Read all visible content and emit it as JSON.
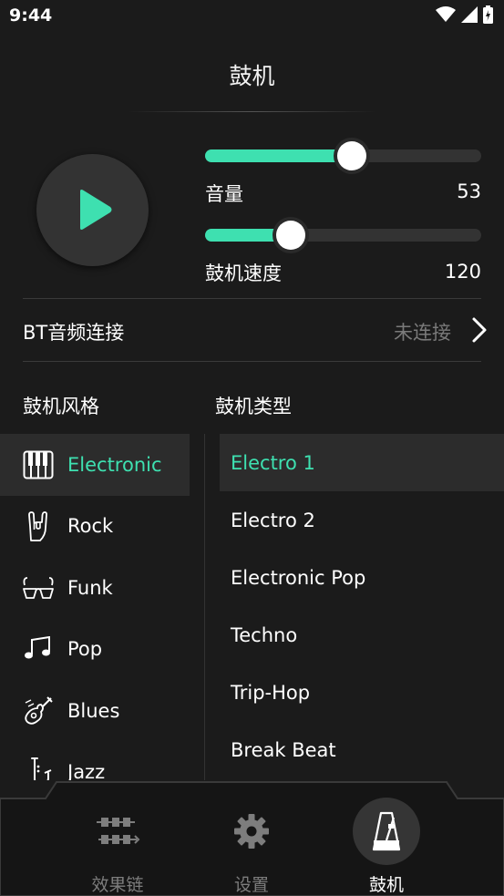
{
  "status_bar": {
    "time": "9:44"
  },
  "header": {
    "title": "鼓机"
  },
  "controls": {
    "volume": {
      "label": "音量",
      "value": "53",
      "level_percent": 53
    },
    "tempo": {
      "label": "鼓机速度",
      "value": "120",
      "level_percent": 31
    }
  },
  "bt": {
    "label": "BT音频连接",
    "status": "未连接"
  },
  "sections": {
    "styles_heading": "鼓机风格",
    "types_heading": "鼓机类型"
  },
  "styles": [
    {
      "label": "Electronic",
      "icon": "piano-keys-icon",
      "active": true
    },
    {
      "label": "Rock",
      "icon": "rock-hand-icon",
      "active": false
    },
    {
      "label": "Funk",
      "icon": "funk-glasses-icon",
      "active": false
    },
    {
      "label": "Pop",
      "icon": "music-notes-icon",
      "active": false
    },
    {
      "label": "Blues",
      "icon": "guitar-icon",
      "active": false
    },
    {
      "label": "Jazz",
      "icon": "saxophone-icon",
      "active": false
    }
  ],
  "types": [
    {
      "label": "Electro 1",
      "active": true
    },
    {
      "label": "Electro 2",
      "active": false
    },
    {
      "label": "Electronic Pop",
      "active": false
    },
    {
      "label": "Techno",
      "active": false
    },
    {
      "label": "Trip-Hop",
      "active": false
    },
    {
      "label": "Break Beat",
      "active": false
    }
  ],
  "nav": [
    {
      "label": "效果链",
      "icon": "effects-chain-icon",
      "active": false
    },
    {
      "label": "设置",
      "icon": "gear-icon",
      "active": false
    },
    {
      "label": "鼓机",
      "icon": "metronome-icon",
      "active": true
    }
  ],
  "colors": {
    "accent": "#3ee0b0",
    "background": "#1b1b1b",
    "muted": "#7a7a7a"
  }
}
